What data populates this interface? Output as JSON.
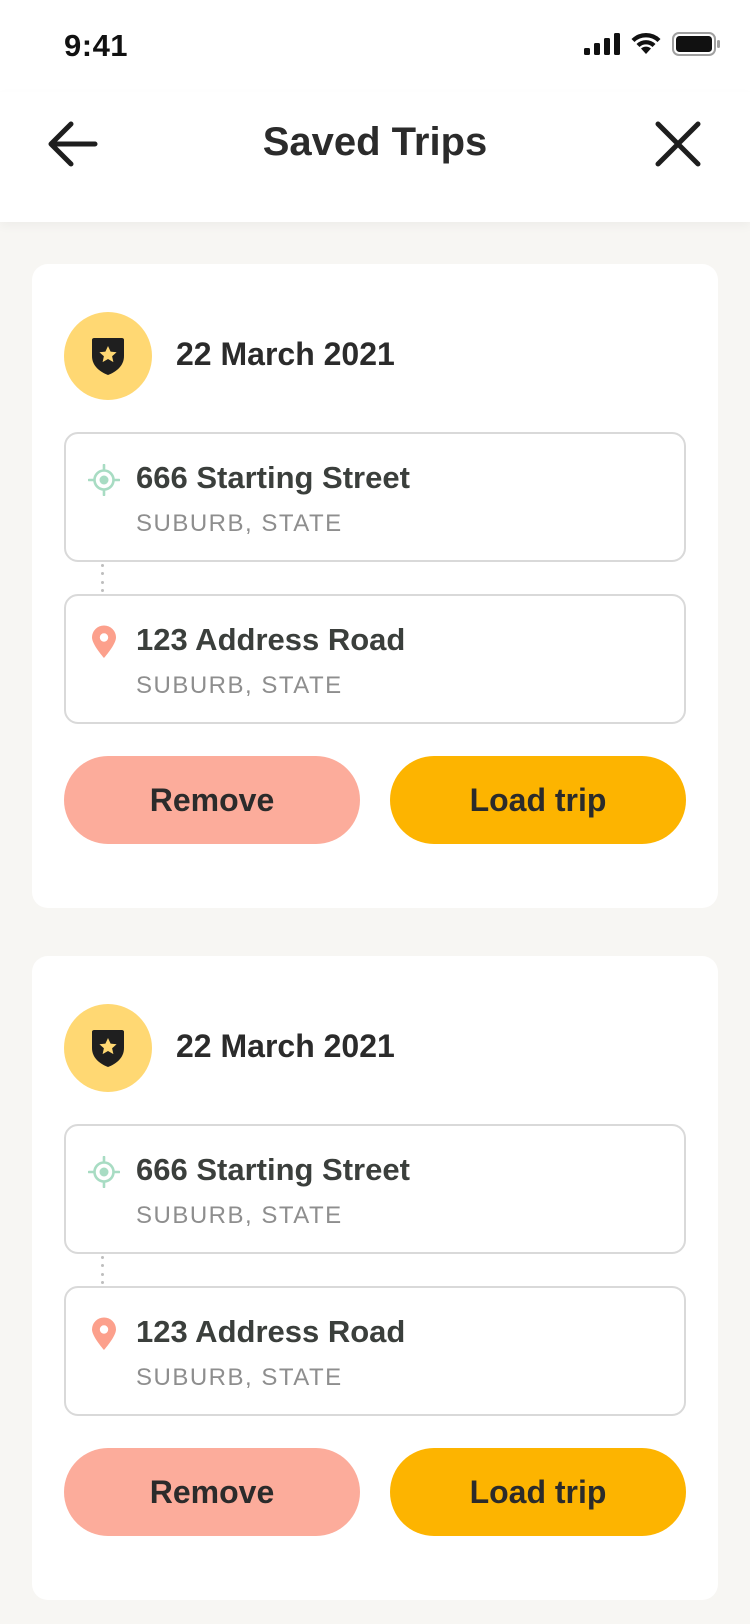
{
  "status_bar": {
    "time": "9:41"
  },
  "header": {
    "title": "Saved Trips"
  },
  "trips": [
    {
      "date": "22 March 2021",
      "start": {
        "title": "666 Starting Street",
        "subtitle": "SUBURB, STATE"
      },
      "destination": {
        "title": "123 Address Road",
        "subtitle": "SUBURB, STATE"
      },
      "remove_label": "Remove",
      "load_label": "Load trip"
    },
    {
      "date": "22 March 2021",
      "start": {
        "title": "666 Starting Street",
        "subtitle": "SUBURB, STATE"
      },
      "destination": {
        "title": "123 Address Road",
        "subtitle": "SUBURB, STATE"
      },
      "remove_label": "Remove",
      "load_label": "Load trip"
    }
  ],
  "colors": {
    "background": "#F7F6F3",
    "badge": "#FFD873",
    "remove": "#FCAC9B",
    "load": "#FDB400",
    "start_icon": "#A8DCC3",
    "destination_icon": "#FCA08C"
  },
  "icons": {
    "back": "arrow-left-icon",
    "close": "close-icon",
    "badge": "shield-star-icon",
    "start": "target-icon",
    "destination": "map-pin-icon"
  }
}
